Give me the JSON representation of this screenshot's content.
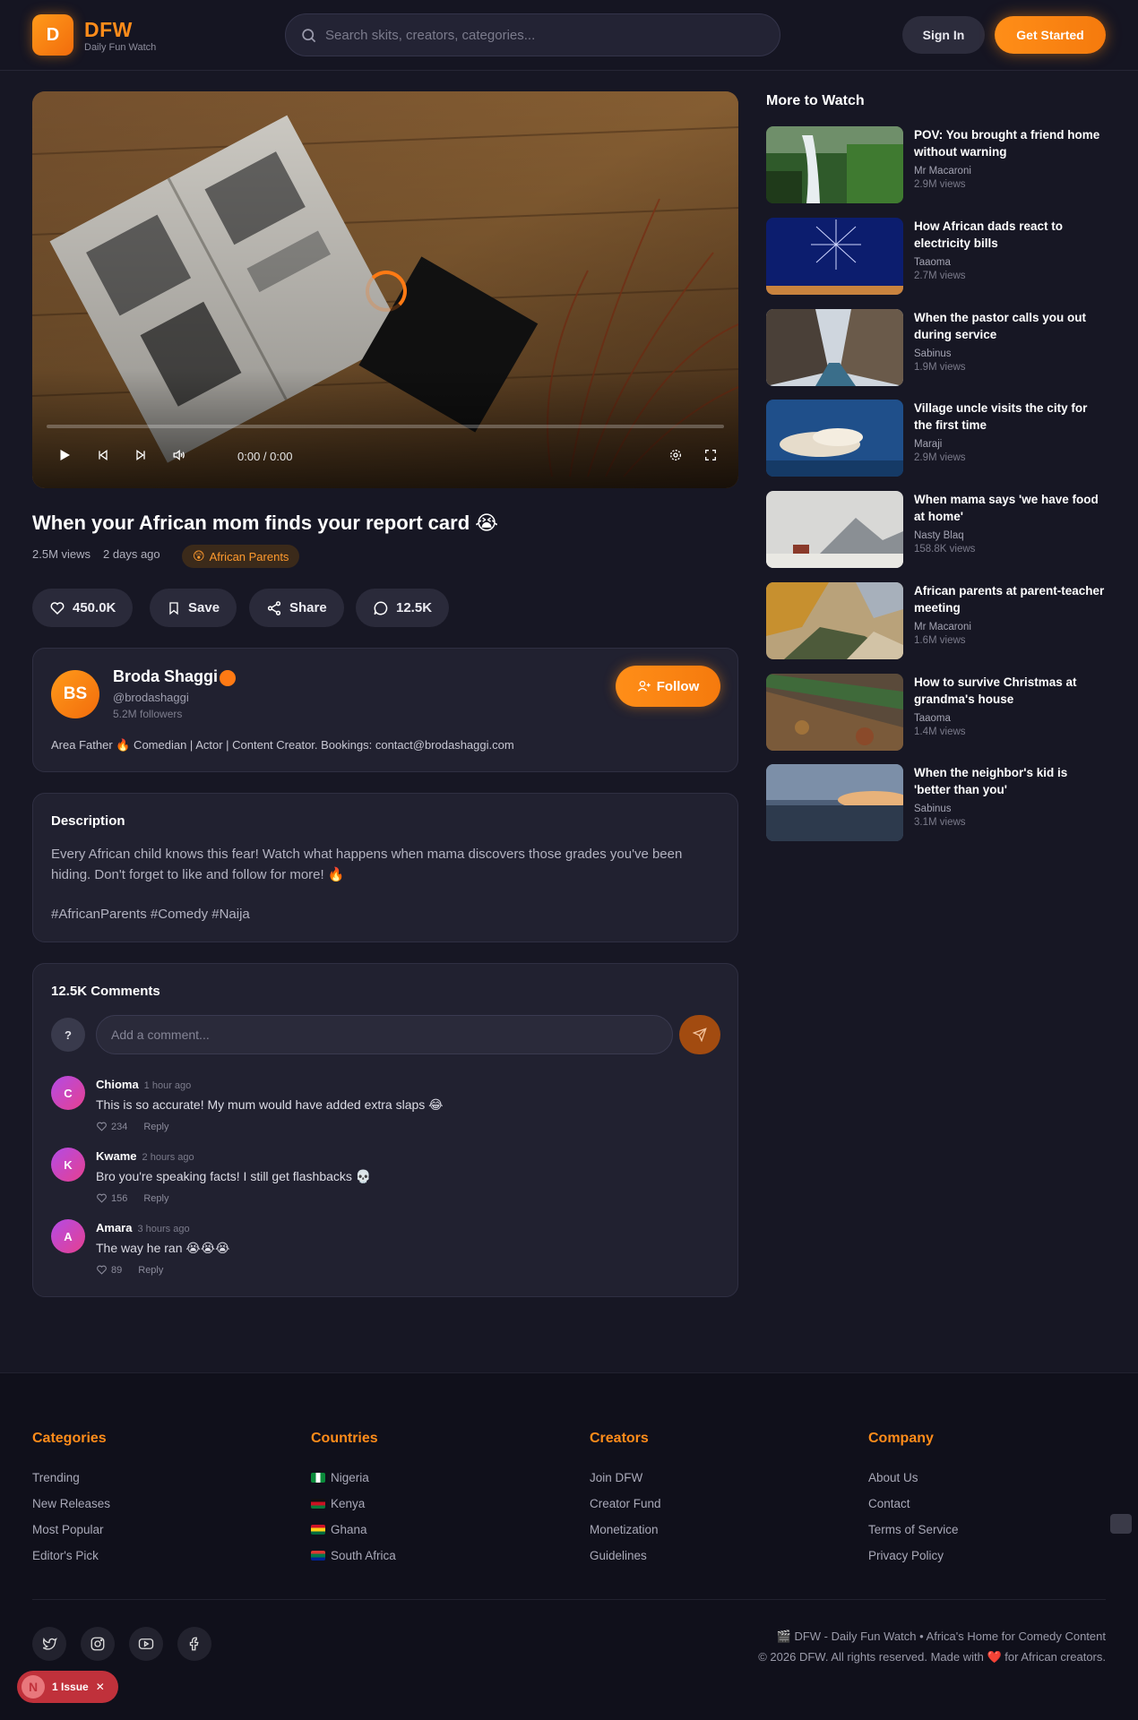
{
  "header": {
    "logo_letter": "D",
    "brand": "DFW",
    "tagline": "Daily Fun Watch",
    "search_placeholder": "Search skits, creators, categories...",
    "sign_in": "Sign In",
    "get_started": "Get Started"
  },
  "player": {
    "time": "0:00 / 0:00",
    "progress": 0
  },
  "video": {
    "title": "When your African mom finds your report card 😭",
    "views": "2.5M views",
    "posted": "2 days ago",
    "category_emoji": "😲",
    "category": "African Parents",
    "likes": "450.0K",
    "save": "Save",
    "share": "Share",
    "comments_count": "12.5K"
  },
  "creator": {
    "initials": "BS",
    "name": "Broda Shaggi",
    "handle": "@brodashaggi",
    "followers": "5.2M followers",
    "follow": "Follow",
    "bio": "Area Father 🔥 Comedian | Actor | Content Creator. Bookings: contact@brodashaggi.com"
  },
  "description": {
    "heading": "Description",
    "text": "Every African child knows this fear! Watch what happens when mama discovers those grades you've been hiding. Don't forget to like and follow for more! 🔥",
    "tags": "#AfricanParents #Comedy #Naija"
  },
  "comments": {
    "heading": "12.5K Comments",
    "me_initial": "?",
    "placeholder": "Add a comment...",
    "reply_label": "Reply",
    "items": [
      {
        "initial": "C",
        "name": "Chioma",
        "time": "1 hour ago",
        "text": "This is so accurate! My mum would have added extra slaps 😂",
        "likes": "234"
      },
      {
        "initial": "K",
        "name": "Kwame",
        "time": "2 hours ago",
        "text": "Bro you're speaking facts! I still get flashbacks 💀",
        "likes": "156"
      },
      {
        "initial": "A",
        "name": "Amara",
        "time": "3 hours ago",
        "text": "The way he ran 😭😭😭",
        "likes": "89"
      }
    ]
  },
  "sidebar": {
    "heading": "More to Watch",
    "items": [
      {
        "title": "POV: You brought a friend home without warning",
        "author": "Mr Macaroni",
        "views": "2.9M views",
        "thumb": "waterfall"
      },
      {
        "title": "How African dads react to electricity bills",
        "author": "Taaoma",
        "views": "2.7M views",
        "thumb": "fireworks"
      },
      {
        "title": "When the pastor calls you out during service",
        "author": "Sabinus",
        "views": "1.9M views",
        "thumb": "city-street"
      },
      {
        "title": "Village uncle visits the city for the first time",
        "author": "Maraji",
        "views": "2.9M views",
        "thumb": "clouds"
      },
      {
        "title": "When mama says 'we have food at home'",
        "author": "Nasty Blaq",
        "views": "158.8K views",
        "thumb": "mountain-church"
      },
      {
        "title": "African parents at parent-teacher meeting",
        "author": "Mr Macaroni",
        "views": "1.6M views",
        "thumb": "autumn-lake"
      },
      {
        "title": "How to survive Christmas at grandma's house",
        "author": "Taaoma",
        "views": "1.4M views",
        "thumb": "bark"
      },
      {
        "title": "When the neighbor's kid is 'better than you'",
        "author": "Sabinus",
        "views": "3.1M views",
        "thumb": "sunset-sea"
      }
    ]
  },
  "footer": {
    "categories": {
      "heading": "Categories",
      "links": [
        "Trending",
        "New Releases",
        "Most Popular",
        "Editor's Pick"
      ]
    },
    "countries": {
      "heading": "Countries",
      "links": [
        "Nigeria",
        "Kenya",
        "Ghana",
        "South Africa"
      ]
    },
    "creators": {
      "heading": "Creators",
      "links": [
        "Join DFW",
        "Creator Fund",
        "Monetization",
        "Guidelines"
      ]
    },
    "company": {
      "heading": "Company",
      "links": [
        "About Us",
        "Contact",
        "Terms of Service",
        "Privacy Policy"
      ]
    },
    "tagline": "🎬 DFW - Daily Fun Watch • Africa's Home for Comedy Content",
    "copyright_pre": "© 2026 DFW. All rights reserved. Made with",
    "copyright_heart": "❤️",
    "copyright_post": "for African creators."
  },
  "issue_badge": {
    "initial": "N",
    "label": "1 Issue",
    "close": "✕"
  },
  "colors": {
    "accent": "#ff8c1a",
    "background": "#171724",
    "card": "#212130",
    "issue": "#c0313b"
  }
}
